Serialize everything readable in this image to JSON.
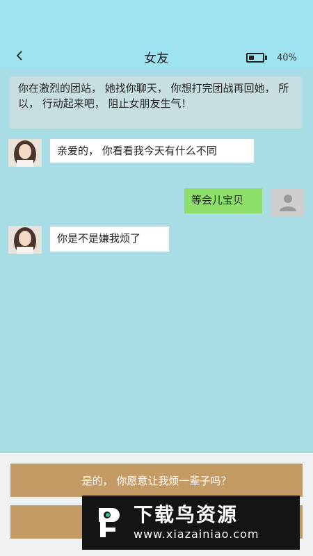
{
  "header": {
    "title": "女友",
    "battery_text": "40%",
    "battery_level": 0.4
  },
  "prompt": {
    "text": "你在激烈的团站， 她找你聊天， 你想打完团战再回她， 所以， 行动起来吧， 阻止女朋友生气！"
  },
  "messages": [
    {
      "side": "left",
      "text": "亲爱的， 你看看我今天有什么不同"
    },
    {
      "side": "right",
      "text": "等会儿宝贝"
    },
    {
      "side": "left",
      "text": "你是不是嫌我烦了"
    }
  ],
  "choices": [
    {
      "label": "是的， 你愿意让我烦一辈子吗？"
    },
    {
      "label": ""
    }
  ],
  "watermark": {
    "title": "下载鸟资源",
    "url": "www.xiazainiao.com"
  },
  "colors": {
    "top_band": "#9ee3f0",
    "chat_bg": "#a8dde6",
    "bubble_left": "#ffffff",
    "bubble_right": "#8ee06a",
    "choice_button": "#c49a65"
  }
}
